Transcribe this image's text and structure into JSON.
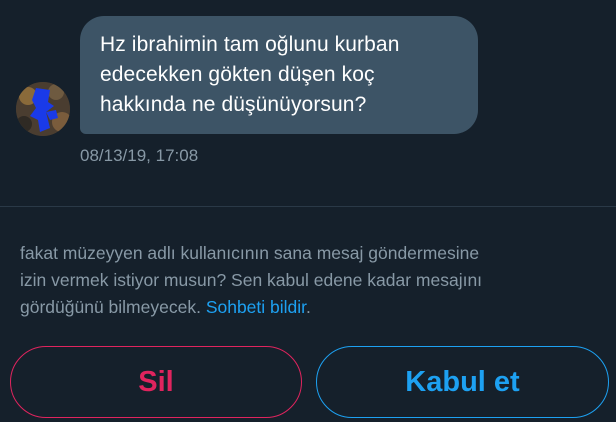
{
  "message": {
    "lines": [
      "Hz ibrahimin tam oğlunu kurban",
      "edecekken gökten düşen koç",
      "hakkında ne düşünüyorsun?"
    ],
    "timestamp": "08/13/19, 17:08"
  },
  "request": {
    "lines": [
      "fakat müzeyyen adlı kullanıcının sana mesaj göndermesine",
      "izin vermek istiyor musun? Sen kabul edene kadar mesajını",
      "gördüğünü bilmeyecek. "
    ],
    "report_link": "Sohbeti bildir",
    "report_suffix": "."
  },
  "actions": {
    "delete_label": "Sil",
    "accept_label": "Kabul et"
  },
  "colors": {
    "background": "#15202b",
    "bubble": "#3d5466",
    "secondary_text": "#8899a6",
    "accent_blue": "#1da1f2",
    "danger_red": "#e0245e"
  }
}
